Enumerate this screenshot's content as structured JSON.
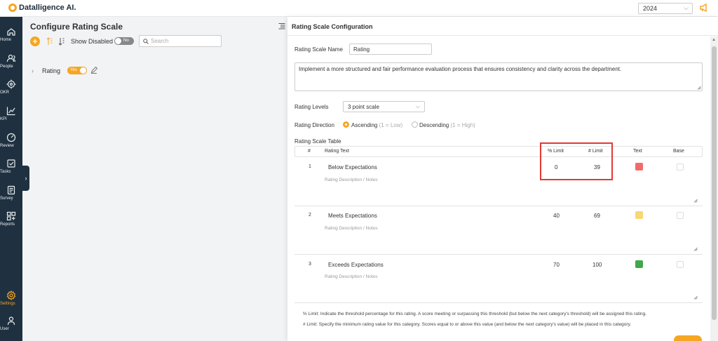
{
  "app": {
    "logo_text": "Datalligence AI."
  },
  "topbar": {
    "year": "2024"
  },
  "sidebar": {
    "items": [
      {
        "label": "Home"
      },
      {
        "label": "People"
      },
      {
        "label": "OKR"
      },
      {
        "label": "KPI"
      },
      {
        "label": "Review"
      },
      {
        "label": "Tasks"
      },
      {
        "label": "Survey"
      },
      {
        "label": "Reports"
      },
      {
        "label": "Settings"
      },
      {
        "label": "User"
      }
    ]
  },
  "left": {
    "title": "Configure Rating Scale",
    "show_disabled_label": "Show Disabled",
    "show_disabled_toggle": "No",
    "search_placeholder": "Search",
    "tree_item": {
      "label": "Rating",
      "toggle": "Yes"
    }
  },
  "panel": {
    "title": "Rating Scale Configuration",
    "name_label": "Rating Scale Name",
    "name_value": "Rating",
    "description": "Implement a more structured and fair performance evaluation process that ensures consistency and clarity across the department.",
    "levels_label": "Rating Levels",
    "levels_value": "3 point scale",
    "direction_label": "Rating Direction",
    "direction_options": [
      {
        "label": "Ascending",
        "hint": "(1 = Low)",
        "selected": true
      },
      {
        "label": "Descending",
        "hint": "(1 = High)",
        "selected": false
      }
    ],
    "table_label": "Rating Scale Table",
    "columns": {
      "num": "#",
      "text": "Rating Text",
      "pct": "% Limit",
      "lim": "# Limit",
      "color": "Text",
      "base": "Base"
    },
    "rows": [
      {
        "num": "1",
        "text": "Below Expectations",
        "notes": "Rating Description / Notes",
        "pct": "0",
        "lim": "39",
        "color": "#f26b6b"
      },
      {
        "num": "2",
        "text": "Meets Expectations",
        "notes": "Rating Description / Notes",
        "pct": "40",
        "lim": "69",
        "color": "#f7d774"
      },
      {
        "num": "3",
        "text": "Exceeds Expectations",
        "notes": "Rating Description / Notes",
        "pct": "70",
        "lim": "100",
        "color": "#3fa84a"
      }
    ],
    "footnotes": [
      "% Limit: Indicate the threshold percentage for this rating. A score meeting or surpassing this threshold (but below the next category's threshold) will be assigned this rating.",
      "# Limit: Specify the minimum rating value for this category. Scores equal to or above this value (and below the next category's value) will be placed in this category."
    ]
  }
}
